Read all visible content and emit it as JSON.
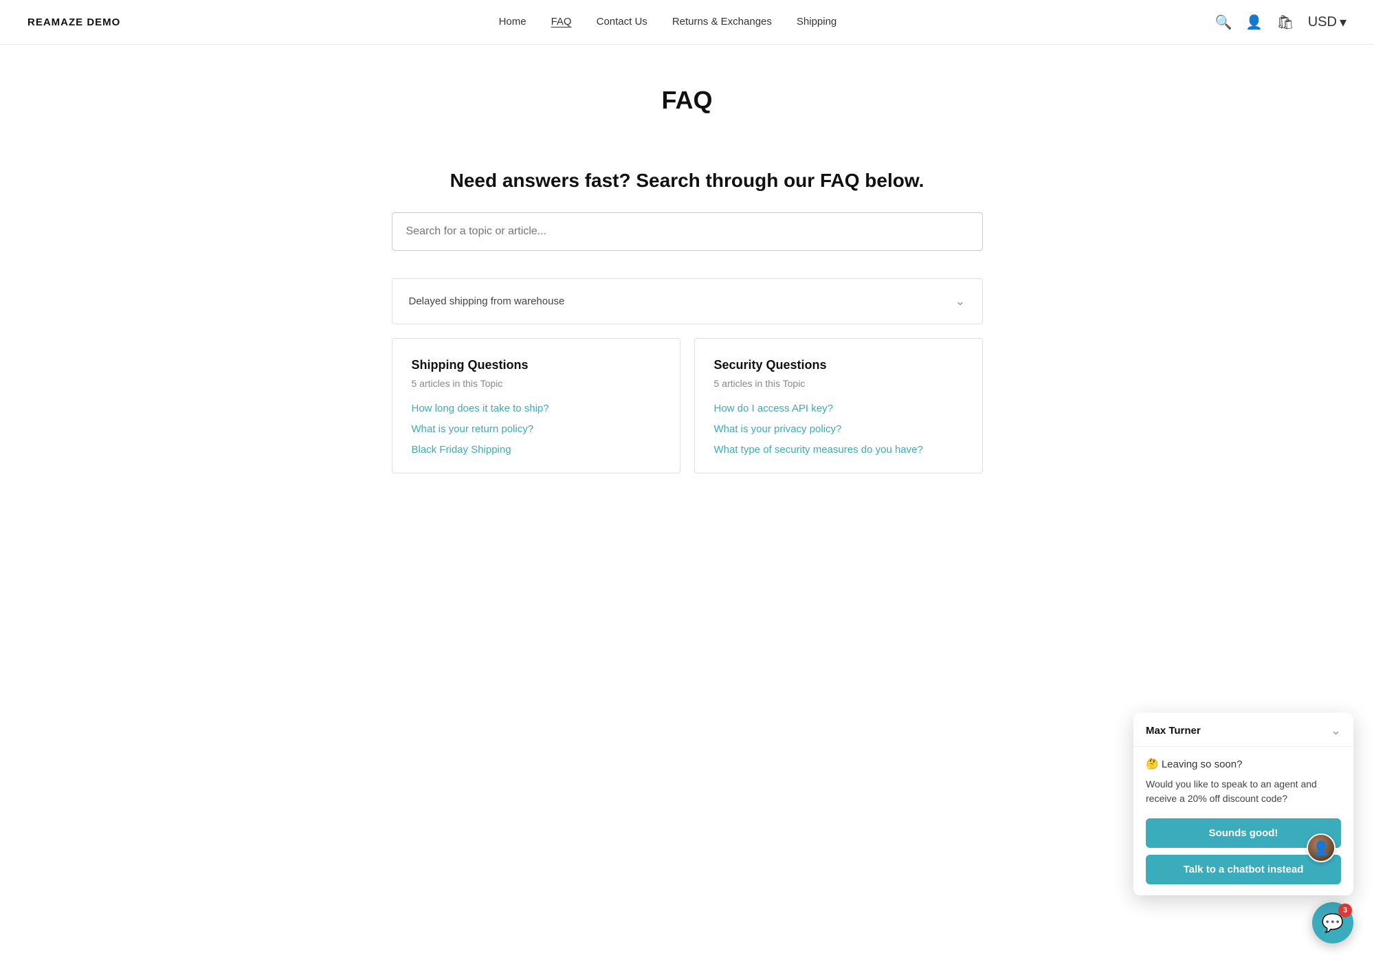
{
  "brand": {
    "name": "REAMAZE DEMO"
  },
  "nav": {
    "links": [
      {
        "label": "Home",
        "active": false
      },
      {
        "label": "FAQ",
        "active": true
      },
      {
        "label": "Contact Us",
        "active": false
      },
      {
        "label": "Returns & Exchanges",
        "active": false
      },
      {
        "label": "Shipping",
        "active": false
      }
    ],
    "currency": "USD",
    "currency_chevron": "▾"
  },
  "page": {
    "title": "FAQ",
    "search_heading": "Need answers fast? Search through our FAQ below.",
    "search_placeholder": "Search for a topic or article..."
  },
  "faq_row": {
    "text": "Delayed shipping from warehouse"
  },
  "topics": [
    {
      "id": "shipping",
      "title": "Shipping Questions",
      "count": "5 articles in this Topic",
      "links": [
        "How long does it take to ship?",
        "What is your return policy?",
        "Black Friday Shipping"
      ]
    },
    {
      "id": "security",
      "title": "Security Questions",
      "count": "5 articles in this Topic",
      "links": [
        "How do I access API key?",
        "What is your privacy policy?",
        "What type of security measures do you have?"
      ]
    }
  ],
  "chat_popup": {
    "agent_name": "Max Turner",
    "leaving_text": "🤔 Leaving so soon?",
    "message": "Would you like to speak to an agent and receive a 20% off discount code?",
    "btn_primary": "Sounds good!",
    "btn_secondary": "Talk to a chatbot instead"
  },
  "chat_button": {
    "badge_count": "3"
  }
}
